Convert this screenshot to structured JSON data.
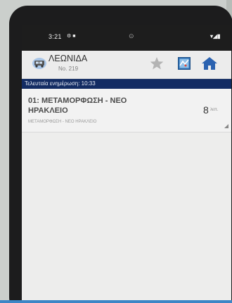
{
  "status_bar": {
    "time": "3:21",
    "left_icons": "⚙ ■",
    "center": "⊙",
    "right": "▾◢▮"
  },
  "header": {
    "stop_name": "ΛΕΩΝΙΔΑ",
    "stop_number": "No. 219",
    "icons": [
      "bus-icon",
      "star-icon",
      "map-icon",
      "home-icon"
    ]
  },
  "update_bar": {
    "text": "Τελευταία ενημέρωση: 10:33"
  },
  "routes": [
    {
      "title": "01: ΜΕΤΑΜΟΡΦΩΣΗ - ΝΕΟ ΗΡΑΚΛΕΙΟ",
      "subtitle": "ΜΕΤΑΜΟΡΦΩΣΗ - ΝΕΟ ΗΡΑΚΛΕΙΟ",
      "minutes": "8",
      "unit": "λεπ."
    }
  ],
  "colors": {
    "update_bar": "#132c63",
    "background": "#cbcfcc",
    "accent_line": "#3d86c6"
  }
}
